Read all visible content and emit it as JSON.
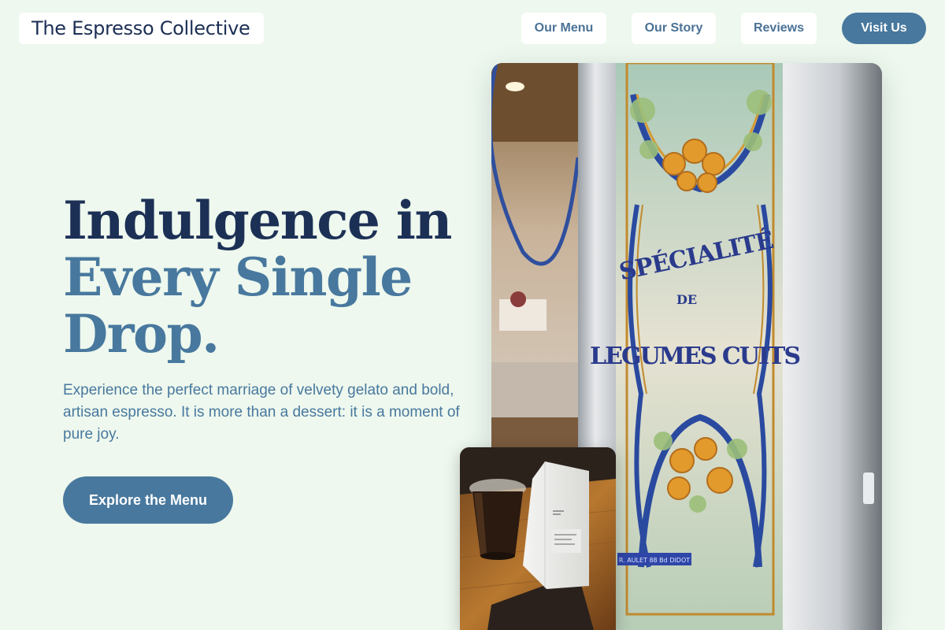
{
  "header": {
    "brand": "The Espresso Collective",
    "nav": [
      "Our Menu",
      "Our Story",
      "Reviews"
    ],
    "cta": "Visit Us"
  },
  "hero": {
    "title_lines": [
      "Indulgence in",
      "Every Single",
      "Drop."
    ],
    "description": "Experience the perfect marriage of velvety gelato and bold, artisan espresso. It is more than a dessert: it is a moment of pure joy.",
    "cta": "Explore the Menu"
  },
  "images": {
    "main": {
      "sign_lines": [
        "SPÉCIALITÉ",
        "DE",
        "LEGUMES CUITS"
      ],
      "footer_label": "R. AULET 88 Bd DIDOT"
    },
    "small": {}
  },
  "colors": {
    "background": "#eef8ee",
    "navy": "#1c3056",
    "accent": "#48789e",
    "white": "#ffffff"
  }
}
